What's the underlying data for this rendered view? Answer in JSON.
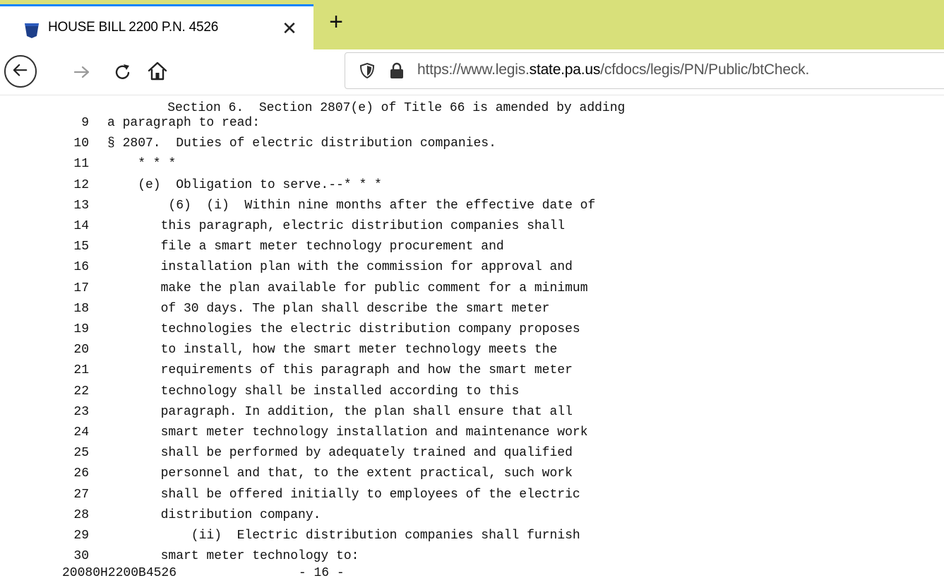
{
  "tab": {
    "title": "HOUSE BILL 2200 P.N. 4526",
    "close_glyph": "✕",
    "new_tab_glyph": "+"
  },
  "address_bar": {
    "url_prefix": "https://www.legis.",
    "url_domain": "state.pa.us",
    "url_path": "/cfdocs/legis/PN/Public/btCheck."
  },
  "document": {
    "partial_top_line": "Section 6.  Section 2807(e) of Title 66 is amended by adding",
    "lines": [
      {
        "num": "9",
        "indent": 0,
        "text": "a paragraph to read:"
      },
      {
        "num": "10",
        "indent": 0,
        "text": "§ 2807.  Duties of electric distribution companies."
      },
      {
        "num": "11",
        "indent": 4,
        "text": "* * *"
      },
      {
        "num": "12",
        "indent": 4,
        "text": "(e)  Obligation to serve.--* * *"
      },
      {
        "num": "13",
        "indent": 8,
        "text": "(6)  (i)  Within nine months after the effective date of"
      },
      {
        "num": "14",
        "indent": 7,
        "text": "this paragraph, electric distribution companies shall"
      },
      {
        "num": "15",
        "indent": 7,
        "text": "file a smart meter technology procurement and"
      },
      {
        "num": "16",
        "indent": 7,
        "text": "installation plan with the commission for approval and"
      },
      {
        "num": "17",
        "indent": 7,
        "text": "make the plan available for public comment for a minimum"
      },
      {
        "num": "18",
        "indent": 7,
        "text": "of 30 days. The plan shall describe the smart meter"
      },
      {
        "num": "19",
        "indent": 7,
        "text": "technologies the electric distribution company proposes"
      },
      {
        "num": "20",
        "indent": 7,
        "text": "to install, how the smart meter technology meets the"
      },
      {
        "num": "21",
        "indent": 7,
        "text": "requirements of this paragraph and how the smart meter"
      },
      {
        "num": "22",
        "indent": 7,
        "text": "technology shall be installed according to this"
      },
      {
        "num": "23",
        "indent": 7,
        "text": "paragraph. In addition, the plan shall ensure that all"
      },
      {
        "num": "24",
        "indent": 7,
        "text": "smart meter technology installation and maintenance work"
      },
      {
        "num": "25",
        "indent": 7,
        "text": "shall be performed by adequately trained and qualified"
      },
      {
        "num": "26",
        "indent": 7,
        "text": "personnel and that, to the extent practical, such work"
      },
      {
        "num": "27",
        "indent": 7,
        "text": "shall be offered initially to employees of the electric"
      },
      {
        "num": "28",
        "indent": 7,
        "text": "distribution company."
      },
      {
        "num": "29",
        "indent": 11,
        "text": "(ii)  Electric distribution companies shall furnish"
      },
      {
        "num": "30",
        "indent": 7,
        "text": "smart meter technology to:"
      }
    ],
    "footer_id": "20080H2200B4526",
    "footer_page": "- 16 -"
  }
}
